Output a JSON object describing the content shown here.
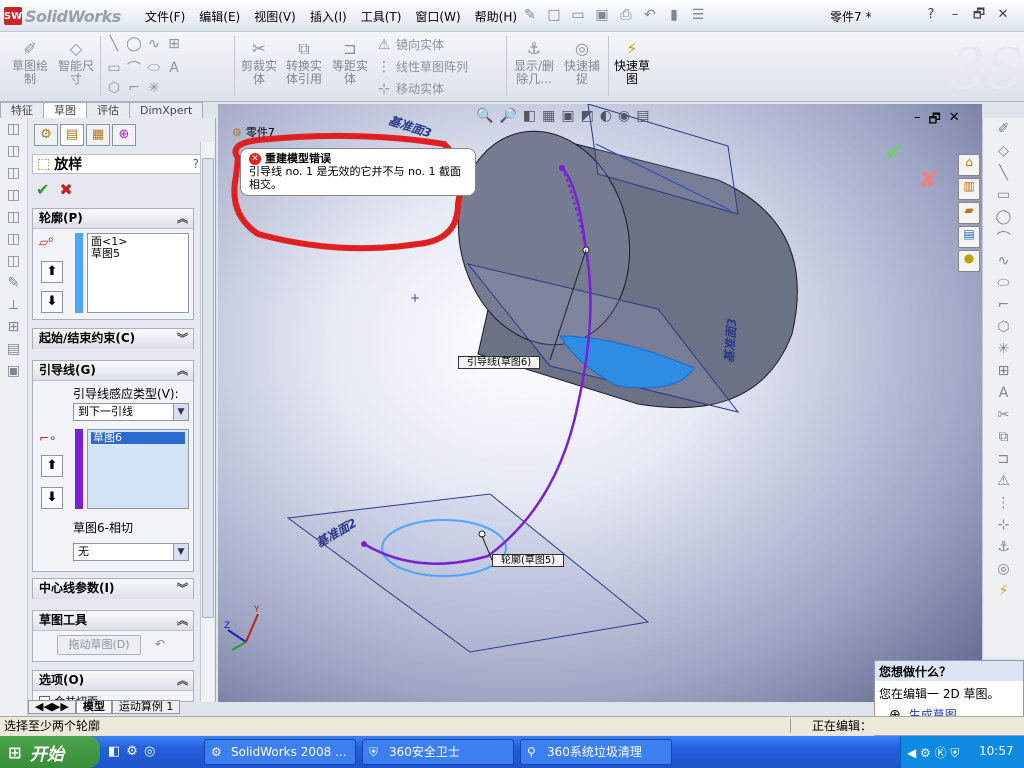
{
  "app": {
    "name": "SolidWorks",
    "doc_title": "零件7 *"
  },
  "menu": [
    "文件(F)",
    "编辑(E)",
    "视图(V)",
    "插入(I)",
    "工具(T)",
    "窗口(W)",
    "帮助(H)"
  ],
  "win_controls": {
    "help": "?",
    "min": "–",
    "restore": "🗗",
    "close": "✕"
  },
  "ribbon": {
    "sketch": "草图绘\n制",
    "smart_dim": "智能尺\n寸",
    "trim": "剪裁实\n体",
    "convert": "转换实\n体引用",
    "offset": "等距实\n体",
    "mirror": "镜向实体",
    "linear_pattern": "线性草图阵列",
    "move": "移动实体",
    "show_delete": "显示/删\n除几...",
    "quick_snap": "快速捕\n捉",
    "rapid_sketch": "快速草\n图"
  },
  "cm_tabs": [
    "特征",
    "草图",
    "评估",
    "DimXpert"
  ],
  "active_cm_tab": "草图",
  "tree_item": "零件7",
  "property_manager": {
    "title": "放样",
    "help": "?",
    "profiles": {
      "header": "轮廓(P)",
      "items": [
        "面<1>",
        "草图5"
      ]
    },
    "start_end": {
      "header": "起始/结束约束(C)"
    },
    "guides": {
      "header": "引导线(G)",
      "influence_label": "引导线感应类型(V):",
      "influence_value": "到下一引线",
      "items": [
        "草图6"
      ],
      "tangency_label": "草图6-相切",
      "tangency_value": "无"
    },
    "centerline": {
      "header": "中心线参数(I)"
    },
    "sketch_tools": {
      "header": "草图工具",
      "drag_btn": "拖动草图(D)"
    },
    "options": {
      "header": "选项(O)",
      "partial": "合并切面"
    }
  },
  "error_callout": {
    "title": "重建模型错误",
    "body": "引导线 no. 1 是无效的它并不与 no. 1 截面相交。"
  },
  "labels": {
    "guide": "引导线(草图6)",
    "profile": "轮廓(草图5)",
    "plane_top": "基准面3",
    "plane_bottom": "基准面2",
    "plane_right": "基准面3"
  },
  "bottom_tabs": [
    "模型",
    "运动算例 1"
  ],
  "status": {
    "left": "选择至少两个轮廓",
    "right": "正在编辑："
  },
  "help_panel": {
    "title": "您想做什么？",
    "line1": "您在编辑一 2D 草图。",
    "link": "生成草图。"
  },
  "taskbar": {
    "start": "开始",
    "items": [
      "SolidWorks 2008 ...",
      "360安全卫士",
      "360系统垃圾清理"
    ],
    "clock": "10:57"
  },
  "colors": {
    "accent_red": "#e02020",
    "guide_purple": "#7b1fd6",
    "profile_blue": "#4da6ff",
    "xp_blue": "#245edc"
  }
}
